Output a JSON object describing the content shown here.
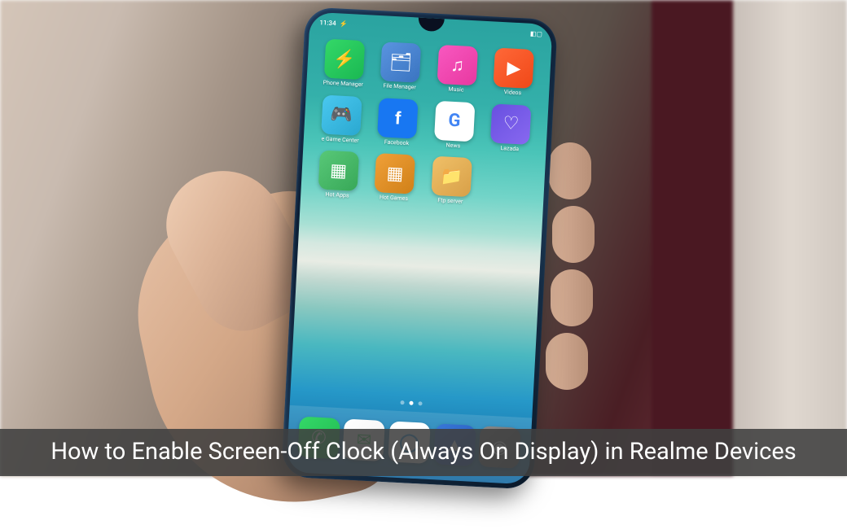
{
  "caption": "How to Enable Screen-Off Clock (Always On Display) in Realme Devices",
  "status": {
    "time": "11:34",
    "carrier": "⚡",
    "battery": "◧▢"
  },
  "apps": {
    "row1": [
      {
        "label": "Phone Manager",
        "glyph": "⚡"
      },
      {
        "label": "File Manager",
        "glyph": "🗂"
      },
      {
        "label": "Music",
        "glyph": "♫"
      },
      {
        "label": "Videos",
        "glyph": "▶"
      }
    ],
    "row2": [
      {
        "label": "e Game Center",
        "glyph": "🎮"
      },
      {
        "label": "Facebook",
        "glyph": "f"
      },
      {
        "label": "News",
        "glyph": "G"
      },
      {
        "label": "Lazada",
        "glyph": "♡"
      }
    ],
    "row3": [
      {
        "label": "Hot Apps",
        "glyph": "▦"
      },
      {
        "label": "Hot Games",
        "glyph": "▦"
      },
      {
        "label": "Ftp server",
        "glyph": "📁"
      }
    ]
  },
  "dock": [
    {
      "name": "phone",
      "glyph": "✆"
    },
    {
      "name": "messages",
      "glyph": "✉"
    },
    {
      "name": "browser",
      "glyph": "◯"
    },
    {
      "name": "gallery",
      "glyph": "▲"
    },
    {
      "name": "camera",
      "glyph": "◉"
    }
  ]
}
